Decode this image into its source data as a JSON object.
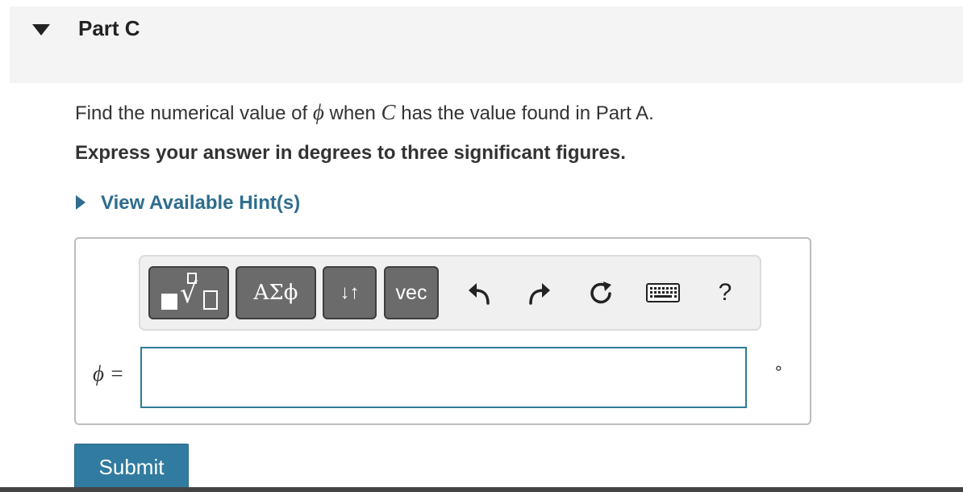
{
  "part": {
    "title": "Part C"
  },
  "question": {
    "text_before": "Find the numerical value of ",
    "var_phi": "ϕ",
    "text_mid": " when ",
    "var_c": "C",
    "text_after": " has the value found in Part A.",
    "instruction": "Express your answer in degrees to three significant figures."
  },
  "hint": {
    "label": "View Available Hint(s)"
  },
  "toolbar": {
    "greek_label": "ΑΣϕ",
    "arrows_label": "↓↑",
    "vec_label": "vec",
    "help_label": "?",
    "icons": [
      "templates-icon",
      "undo-icon",
      "redo-icon",
      "reset-icon",
      "keyboard-icon",
      "help-icon"
    ]
  },
  "answer": {
    "variable_label": "ϕ =",
    "value": "",
    "units": "∘"
  },
  "submit": {
    "label": "Submit"
  },
  "colors": {
    "accent_link": "#2e6d8e",
    "submit_bg": "#327ba0",
    "input_border": "#2e7b98",
    "toolbar_button": "#6b6b6b"
  }
}
